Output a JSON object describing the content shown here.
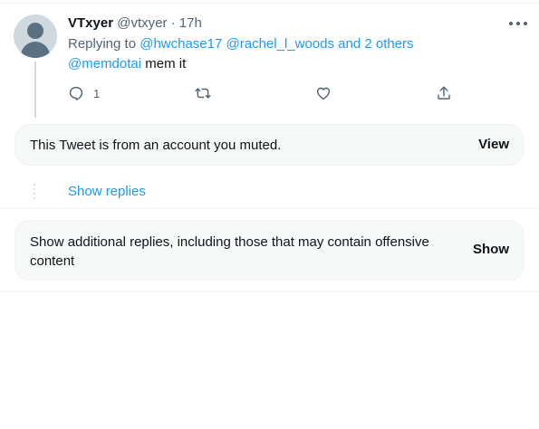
{
  "tweet": {
    "display_name": "VTxyer",
    "handle": "@vtxyer",
    "separator": "·",
    "time": "17h",
    "replying_prefix": "Replying to",
    "reply_targets": [
      "@hwchase17",
      "@rachel_l_woods",
      "and 2 others"
    ],
    "mention": "@memdotai",
    "text": "mem it",
    "actions": {
      "reply_count": "1",
      "retweet_count": "",
      "like_count": ""
    }
  },
  "muted_notice": {
    "text": "This Tweet is from an account you muted.",
    "button": "View"
  },
  "show_replies": "Show replies",
  "additional_replies": {
    "text": "Show additional replies, including those that may contain offensive content",
    "button": "Show"
  },
  "colors": {
    "link": "#1d9bf0",
    "muted_text": "#536471",
    "card_bg": "#f7f9f9"
  }
}
